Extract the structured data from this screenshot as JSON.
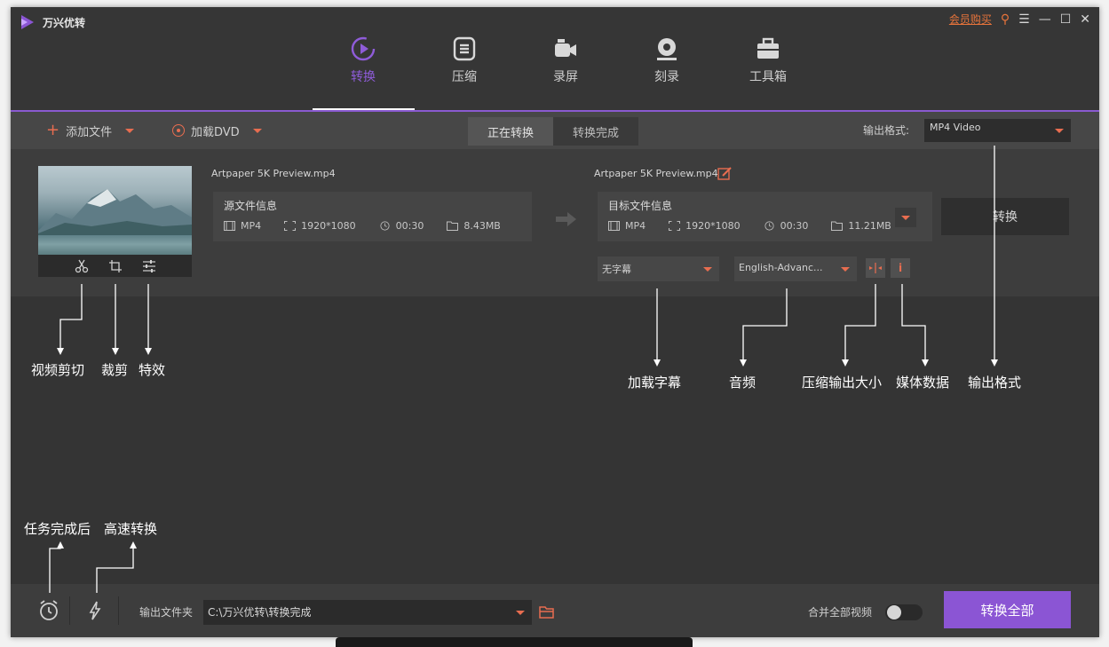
{
  "app": {
    "name": "万兴优转"
  },
  "window_controls": {
    "buy_label": "会员购买",
    "key_icon": "key-icon",
    "menu_icon": "menu-icon",
    "minimize_icon": "minimize-icon",
    "maximize_icon": "maximize-icon",
    "close_icon": "close-icon"
  },
  "main_tabs": [
    {
      "label": "转换",
      "icon": "convert-icon",
      "active": true
    },
    {
      "label": "压缩",
      "icon": "compress-icon",
      "active": false
    },
    {
      "label": "录屏",
      "icon": "record-icon",
      "active": false
    },
    {
      "label": "刻录",
      "icon": "burn-icon",
      "active": false
    },
    {
      "label": "工具箱",
      "icon": "toolbox-icon",
      "active": false
    }
  ],
  "toolbar": {
    "add_file": "添加文件",
    "load_dvd": "加载DVD",
    "seg_converting": "正在转换",
    "seg_done": "转换完成",
    "output_format_label": "输出格式:",
    "output_format_value": "MP4 Video"
  },
  "file": {
    "source_name": "Artpaper 5K Preview.mp4",
    "target_name": "Artpaper 5K Preview.mp4",
    "source": {
      "title": "源文件信息",
      "format": "MP4",
      "resolution": "1920*1080",
      "duration": "00:30",
      "size": "8.43MB"
    },
    "target": {
      "title": "目标文件信息",
      "format": "MP4",
      "resolution": "1920*1080",
      "duration": "00:30",
      "size": "11.21MB"
    },
    "convert_button": "转换",
    "subtitle_select": "无字幕",
    "audio_select": "English-Advanc...",
    "compress_icon": "compress-output-icon",
    "info_icon": "info-icon"
  },
  "bottom": {
    "folder_label": "输出文件夹",
    "folder_path": "C:\\万兴优转\\转换完成",
    "merge_label": "合并全部视频",
    "merge_on": false,
    "convert_all": "转换全部"
  },
  "callouts": {
    "trim": "视频剪切",
    "crop": "裁剪",
    "effect": "特效",
    "subtitle": "加载字幕",
    "audio": "音频",
    "compress": "压缩输出大小",
    "metadata": "媒体数据",
    "format": "输出格式",
    "after_done": "任务完成后",
    "high_speed": "高速转换"
  },
  "colors": {
    "accent": "#8b55d4",
    "orange": "#e86d50",
    "bg_dark": "#3d3d3d"
  }
}
